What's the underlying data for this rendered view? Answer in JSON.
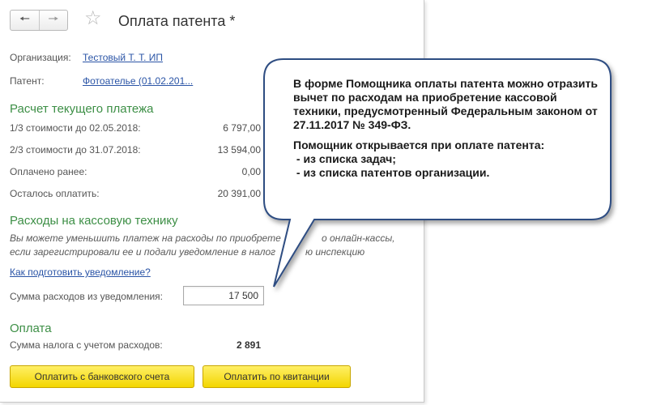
{
  "header": {
    "back_icon": "arrow-left",
    "forward_icon": "arrow-right",
    "favorite_icon": "star",
    "title": "Оплата патента *"
  },
  "fields": {
    "organization_label": "Организация:",
    "organization_value": "Тестовый Т. Т. ИП",
    "patent_label": "Патент:",
    "patent_value": "Фотоателье (01.02.201..."
  },
  "current_payment": {
    "heading": "Расчет текущего платежа",
    "rows": [
      {
        "label": "1/3 стоимости до 02.05.2018:",
        "value": "6 797,00"
      },
      {
        "label": "2/3 стоимости до 31.07.2018:",
        "value": "13 594,00"
      },
      {
        "label": "Оплачено ранее:",
        "value": "0,00"
      },
      {
        "label": "Осталось оплатить:",
        "value": "20 391,00"
      }
    ]
  },
  "cash_register": {
    "heading": "Расходы на кассовую технику",
    "note_line1": "Вы можете уменьшить платеж на расходы по приобрете",
    "note_line1_tail": "о онлайн-кассы,",
    "note_line2": "если зарегистрировали ее и подали уведомление в налог",
    "note_line2_tail": "ю инспекцию",
    "how_to_link": "Как подготовить уведомление?",
    "amount_label": "Сумма расходов из уведомления:",
    "amount_value": "17 500"
  },
  "payment": {
    "heading": "Оплата",
    "tax_label": "Сумма налога с учетом расходов:",
    "tax_value": "2 891",
    "pay_bank_button": "Оплатить с банковского счета",
    "pay_receipt_button": "Оплатить по квитанции"
  },
  "callout": {
    "paragraph1": "В форме Помощника оплаты патента можно отразить вычет по расходам на приобретение кассовой техники, предусмотренный Федеральным законом от 27.11.2017 № 349-ФЗ.",
    "paragraph2": "Помощник открывается при оплате патента:",
    "bullet1": " - из списка задач;",
    "bullet2": " - из списка патентов организации."
  },
  "colors": {
    "section_heading": "#3d8f46",
    "link": "#2a54a6",
    "button_yellow": "#f3d600",
    "callout_fill": "#ffffff",
    "callout_border": "#2f4d82"
  }
}
